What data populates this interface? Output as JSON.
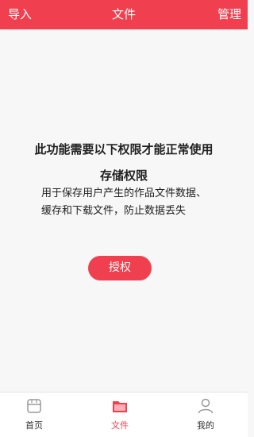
{
  "topbar": {
    "import_label": "导入",
    "title": "文件",
    "manage_label": "管理"
  },
  "permission": {
    "heading": "此功能需要以下权限才能正常使用",
    "permission_name": "存储权限",
    "description": "用于保存用户产生的作品文件数据、缓存和下载文件，防止数据丢失",
    "authorize_label": "授权"
  },
  "tabbar": {
    "items": [
      {
        "label": "首页",
        "icon": "home-icon",
        "active": false
      },
      {
        "label": "文件",
        "icon": "folder-icon",
        "active": true
      },
      {
        "label": "我的",
        "icon": "user-icon",
        "active": false
      }
    ]
  },
  "colors": {
    "accent": "#f0404f",
    "background": "#f7f7f7"
  }
}
